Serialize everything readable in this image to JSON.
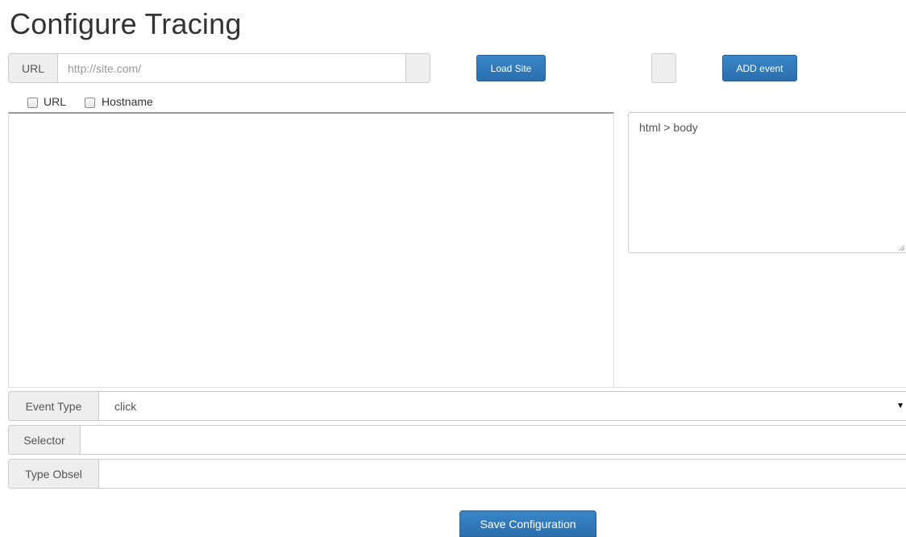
{
  "page": {
    "title": "Configure Tracing"
  },
  "url_group": {
    "addon_label": "URL",
    "placeholder": "http://site.com/",
    "value": ""
  },
  "buttons": {
    "load_site": "Load Site",
    "add_event": "ADD event",
    "save": "Save Configuration"
  },
  "checkboxes": [
    {
      "label": "URL",
      "checked": false
    },
    {
      "label": "Hostname",
      "checked": false
    }
  ],
  "selector_preview": {
    "text": "html > body"
  },
  "event_type": {
    "label": "Event Type",
    "selected": "click"
  },
  "selector": {
    "label": "Selector",
    "value": ""
  },
  "type_obsel": {
    "label": "Type Obsel",
    "value": ""
  },
  "colors": {
    "primary": "#337ab7",
    "addon_bg": "#eeeeee",
    "border": "#cccccc"
  },
  "icons": {
    "dropdown": "triangle-down-icon"
  }
}
